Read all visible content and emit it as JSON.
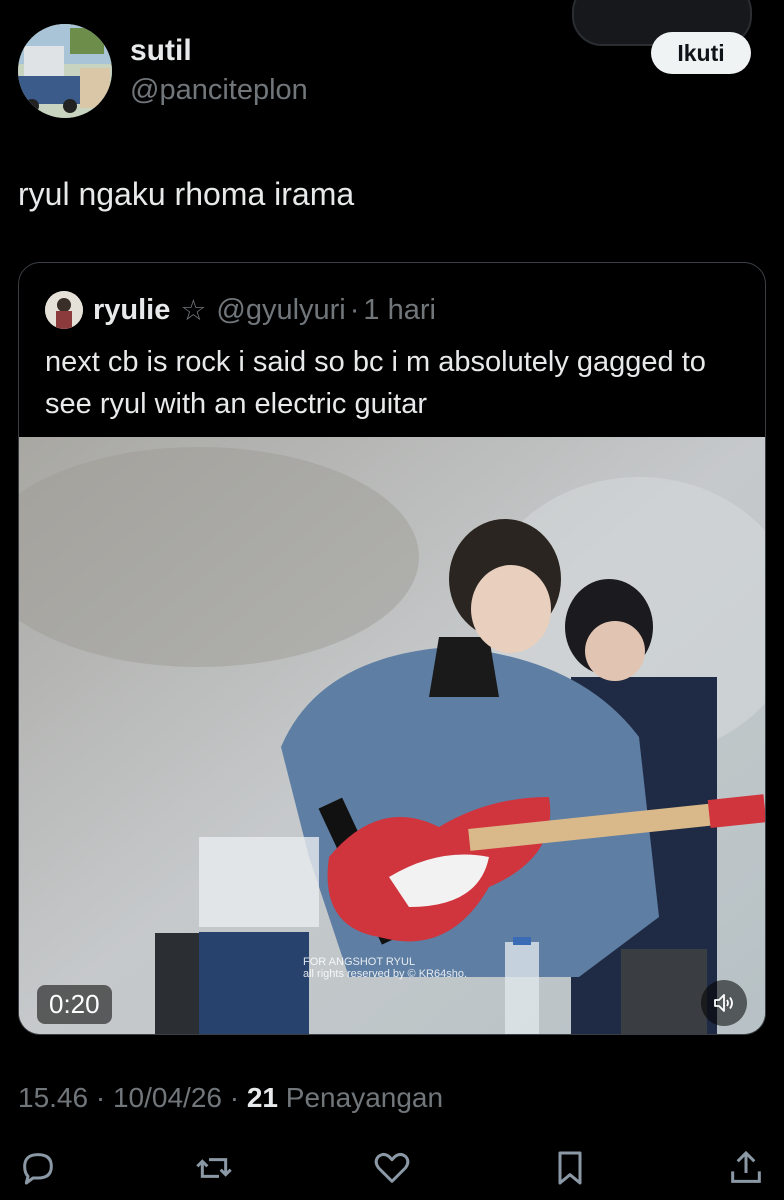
{
  "author": {
    "name": "sutil",
    "handle": "@panciteplon",
    "follow_label": "Ikuti"
  },
  "tweet": {
    "text": "ryul ngaku rhoma irama"
  },
  "quote": {
    "name": "ryulie",
    "star": "☆",
    "handle": "@gyulyuri",
    "sep": "·",
    "time": "1 hari",
    "text": "next cb is rock i said so bc i m absolutely gagged to see ryul with an electric guitar",
    "media": {
      "duration": "0:20",
      "watermark_line1": "FOR ANGSHOT RYUL",
      "watermark_line2": "all rights reserved by © KR64sho."
    }
  },
  "meta": {
    "time": "15.46",
    "sep1": "·",
    "date": "10/04/26",
    "sep2": "·",
    "views_count": "21",
    "views_label": "Penayangan"
  },
  "colors": {
    "background": "#000000",
    "text": "#e7e9ea",
    "muted": "#71767b",
    "border": "#3b3f44"
  },
  "icons": [
    "reply-icon",
    "repost-icon",
    "like-icon",
    "bookmark-icon",
    "share-icon",
    "sound-icon"
  ]
}
